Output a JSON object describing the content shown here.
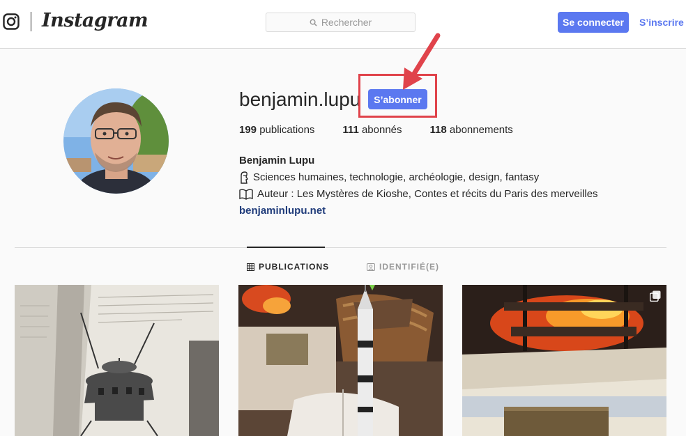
{
  "nav": {
    "logo_text": "Instagram",
    "search_placeholder": "Rechercher",
    "login_label": "Se connecter",
    "signup_label": "S’inscrire"
  },
  "profile": {
    "username": "benjamin.lupu",
    "follow_label": "S’abonner",
    "stats": [
      {
        "count": "199",
        "label": "publications"
      },
      {
        "count": "111",
        "label": "abonnés"
      },
      {
        "count": "118",
        "label": "abonnements"
      }
    ],
    "full_name": "Benjamin Lupu",
    "bio_lines": [
      {
        "icon": "moai-icon",
        "text": "Sciences humaines, technologie, archéologie, design, fantasy"
      },
      {
        "icon": "book-icon",
        "text": "Auteur : Les Mystères de Kioshe, Contes et récits du Paris des merveilles"
      }
    ],
    "website": "benjaminlupu.net"
  },
  "tabs": [
    {
      "label": "PUBLICATIONS",
      "icon": "grid-icon",
      "active": true
    },
    {
      "label": "IDENTIFIÉ(E)",
      "icon": "tagged-user-icon",
      "active": false
    }
  ],
  "posts": [
    {
      "subject": "book page with lunar lander illustration"
    },
    {
      "subject": "toy rocket on a book in front of a fireplace"
    },
    {
      "subject": "fire burning in a fireplace",
      "multi": true
    }
  ],
  "colors": {
    "accent": "#5b78f0",
    "highlight": "#e0434b"
  }
}
